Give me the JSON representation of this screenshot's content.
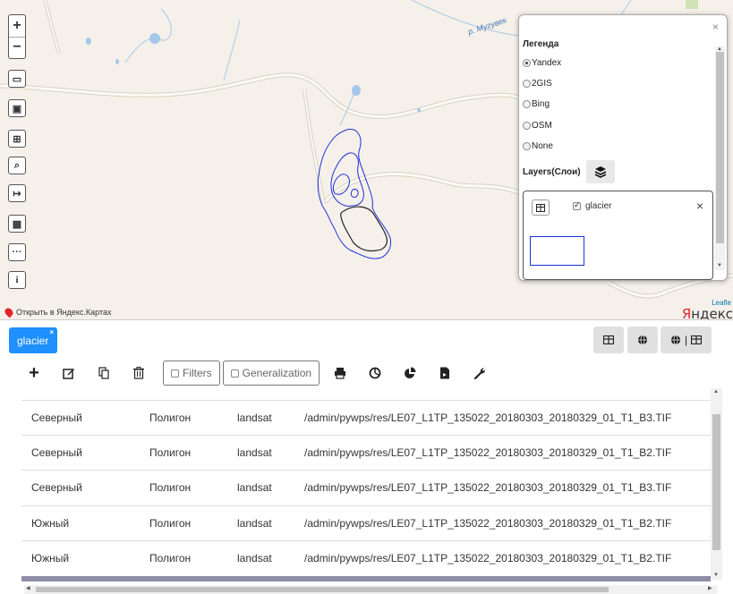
{
  "map": {
    "river_label": "р. Мугувек",
    "attribution": "Открыть в Яндекс.Картах",
    "leaflet_credit": "Leafle",
    "yandex_logo_y": "Я",
    "yandex_logo_rest": "ндекс",
    "zoom_in": "+",
    "zoom_out": "−",
    "tools": [
      "ruler-icon",
      "database-icon",
      "table-icon",
      "search-icon",
      "sign-in-icon",
      "calculator-icon",
      "ellipsis-icon",
      "info-icon"
    ],
    "tool_glyphs": [
      "▭",
      "▣",
      "⊞",
      "⌕",
      "↦",
      "▦",
      "···",
      "i"
    ]
  },
  "legend": {
    "close": "×",
    "title": "Легенда",
    "basemaps": [
      {
        "label": "Yandex",
        "selected": true
      },
      {
        "label": "2GIS",
        "selected": false
      },
      {
        "label": "Bing",
        "selected": false
      },
      {
        "label": "OSM",
        "selected": false
      },
      {
        "label": "None",
        "selected": false
      }
    ],
    "layers_label": "Layers(Слои)",
    "layer": {
      "name": "glacier",
      "checked": true,
      "remove": "×",
      "stroke_color": "#1f2fd8"
    }
  },
  "panel": {
    "tab": {
      "label": "glacier",
      "close": "×",
      "color": "#1e90ff"
    },
    "view_buttons": [
      "table-icon",
      "globe-icon",
      "globe-table-icon"
    ],
    "toolbar": {
      "add": "+",
      "filters_label": "Filters",
      "generalization_label": "Generalization",
      "icons_left": [
        "plus-icon",
        "edit-icon",
        "copy-icon",
        "trash-icon"
      ],
      "icons_right": [
        "print-icon",
        "chart-pie-icon",
        "chart-pie-alt-icon",
        "file-icon",
        "wrench-icon"
      ]
    },
    "rows": [
      {
        "region": "Северный",
        "geometry": "Полигон",
        "source": "landsat",
        "path": "/admin/pywps/res/LE07_L1TP_135022_20180303_20180329_01_T1_B3.TIF"
      },
      {
        "region": "Северный",
        "geometry": "Полигон",
        "source": "landsat",
        "path": "/admin/pywps/res/LE07_L1TP_135022_20180303_20180329_01_T1_B2.TIF"
      },
      {
        "region": "Северный",
        "geometry": "Полигон",
        "source": "landsat",
        "path": "/admin/pywps/res/LE07_L1TP_135022_20180303_20180329_01_T1_B3.TIF"
      },
      {
        "region": "Южный",
        "geometry": "Полигон",
        "source": "landsat",
        "path": "/admin/pywps/res/LE07_L1TP_135022_20180303_20180329_01_T1_B2.TIF"
      },
      {
        "region": "Южный",
        "geometry": "Полигон",
        "source": "landsat",
        "path": "/admin/pywps/res/LE07_L1TP_135022_20180303_20180329_01_T1_B2.TIF"
      }
    ]
  }
}
